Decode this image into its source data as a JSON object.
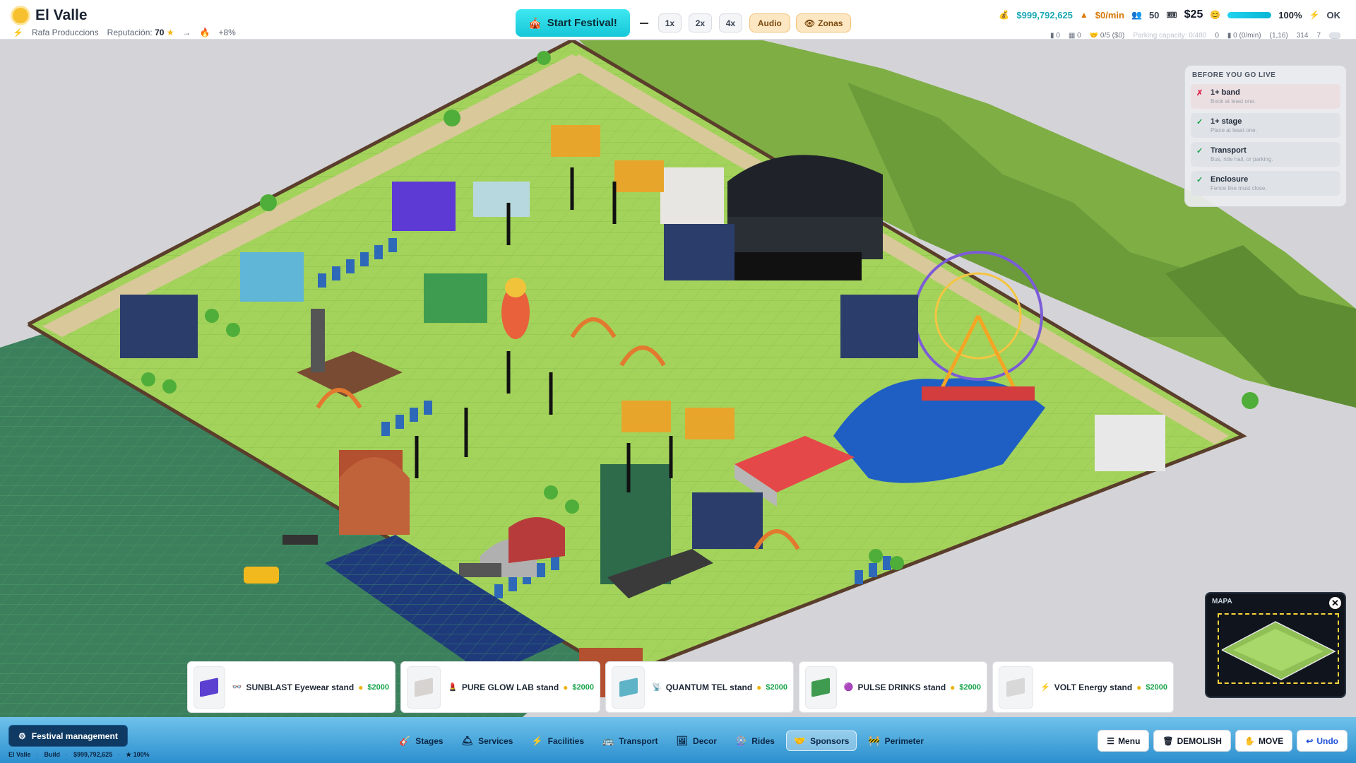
{
  "header": {
    "title": "El Valle",
    "company": "Rafa Produccions",
    "reputation_label": "Reputación:",
    "reputation_value": "70",
    "arrow": "→",
    "trend": "+8%"
  },
  "controls": {
    "start_label": "Start Festival!",
    "speed_1": "1x",
    "speed_2": "2x",
    "speed_4": "4x",
    "audio_label": "Audio",
    "zonas_label": "Zonas"
  },
  "stats": {
    "money": "$999,792,625",
    "rate": "$0/min",
    "attendees": "50",
    "ticket_price": "$25",
    "satisfaction_pct": 100,
    "satisfaction_label": "100%",
    "power": "OK"
  },
  "substats": {
    "a": "0",
    "b": "0",
    "sponsors": "0/5 ($0)",
    "parking": "Parking capacity: 0/480",
    "c": "0",
    "d": "0 (0/min)",
    "coords": "(1,16)",
    "e": "314",
    "f": "7"
  },
  "checklist": {
    "title": "BEFORE YOU GO LIVE",
    "items": [
      {
        "mark": "✗",
        "name": "1+ band",
        "desc": "Book at least one."
      },
      {
        "mark": "✓",
        "name": "1+ stage",
        "desc": "Place at least one."
      },
      {
        "mark": "✓",
        "name": "Transport",
        "desc": "Bus, ride hail, or parking."
      },
      {
        "mark": "✓",
        "name": "Enclosure",
        "desc": "Fence line must close."
      }
    ]
  },
  "minimap": {
    "label": "MAPA",
    "close": "✕"
  },
  "cards": [
    {
      "icon": "👓",
      "name": "SUNBLAST Eyewear stand",
      "price": "$2000",
      "color": "#5b3fd0"
    },
    {
      "icon": "💄",
      "name": "PURE GLOW LAB stand",
      "price": "$2000",
      "color": "#d6d3d1"
    },
    {
      "icon": "📡",
      "name": "QUANTUM TEL stand",
      "price": "$2000",
      "color": "#5fb3c7"
    },
    {
      "icon": "🟣",
      "name": "PULSE DRINKS stand",
      "price": "$2000",
      "color": "#3f9b4f"
    },
    {
      "icon": "⚡",
      "name": "VOLT Energy stand",
      "price": "$2000",
      "color": "#d8d8d8"
    }
  ],
  "bottom": {
    "management": "Festival management",
    "status": {
      "place": "El Valle",
      "mode": "Build",
      "money": "$999,792,625",
      "rating": "★ 100%"
    },
    "categories": [
      {
        "icon": "🎸",
        "label": "Stages"
      },
      {
        "icon": "🛎",
        "label": "Services"
      },
      {
        "icon": "⚡",
        "label": "Facilities"
      },
      {
        "icon": "🚌",
        "label": "Transport"
      },
      {
        "icon": "🖼",
        "label": "Decor"
      },
      {
        "icon": "🎡",
        "label": "Rides"
      },
      {
        "icon": "🤝",
        "label": "Sponsors"
      },
      {
        "icon": "🚧",
        "label": "Perimeter"
      }
    ],
    "menu": "Menu",
    "demolish": "DEMOLISH",
    "move": "MOVE",
    "undo": "Undo"
  },
  "colors": {
    "accent": "#16c7d8",
    "grass": "#9fd35a",
    "bar": "#2c8fcf"
  }
}
